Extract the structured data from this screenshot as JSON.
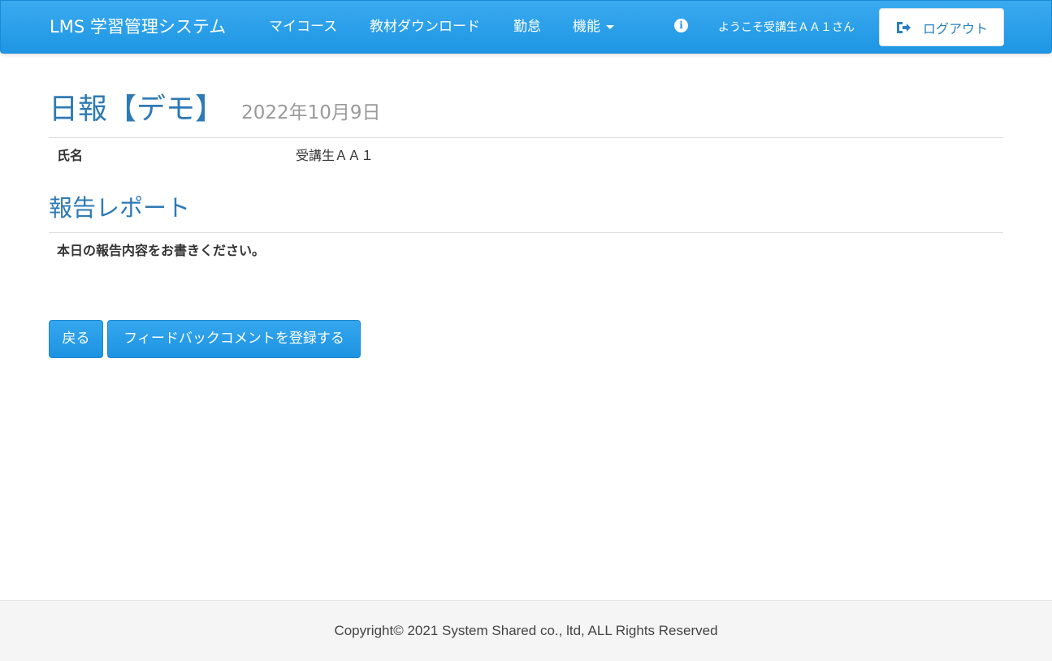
{
  "navbar": {
    "brand": "LMS 学習管理システム",
    "items": [
      {
        "label": "マイコース"
      },
      {
        "label": "教材ダウンロード"
      },
      {
        "label": "勤怠"
      },
      {
        "label": "機能"
      }
    ],
    "info_icon": "info-circle-icon",
    "welcome": "ようこそ受講生ＡＡ１さん",
    "logout_label": "ログアウト",
    "logout_icon": "sign-out-icon"
  },
  "page": {
    "title": "日報【デモ】",
    "date": "2022年10月9日",
    "name_label": "氏名",
    "name_value": "受講生ＡＡ１",
    "section_title": "報告レポート",
    "question": "本日の報告内容をお書きください。",
    "answer": ""
  },
  "actions": {
    "back_label": "戻る",
    "feedback_label": "フィードバックコメントを登録する"
  },
  "footer": {
    "copyright": "Copyright© 2021 System Shared co., ltd, ALL Rights Reserved"
  },
  "colors": {
    "navbar": "#1e96e3",
    "title": "#2e7ab5",
    "button": "#1d93e1"
  }
}
